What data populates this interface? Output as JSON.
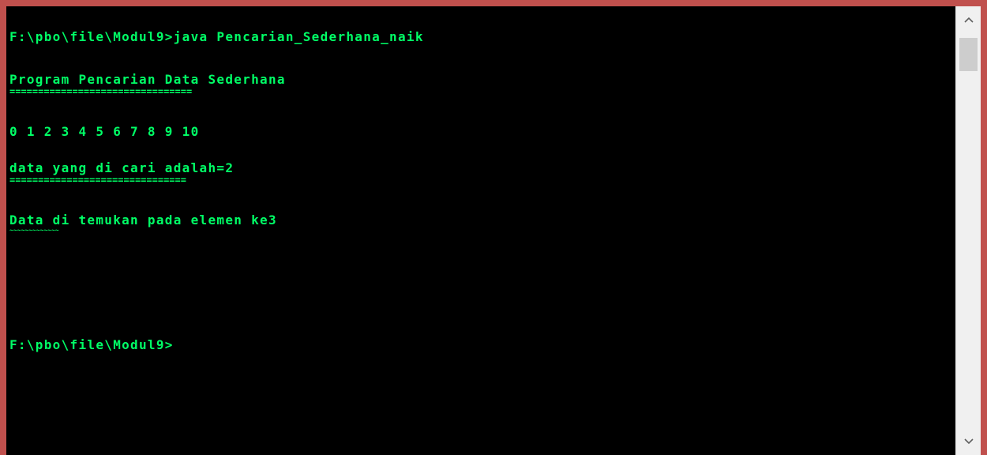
{
  "console": {
    "lines": [
      "F:\\pbo\\file\\Modul9>java Pencarian_Sederhana_naik",
      "Program Pencarian Data Sederhana",
      "0 1 2 3 4 5 6 7 8 9 10",
      "data yang di cari adalah=2",
      "Data di temukan pada elemen ke3",
      "F:\\pbo\\file\\Modul9>"
    ],
    "separators": [
      "================================",
      "==============================="
    ],
    "squiggle": "~~~~~~~~~~~~~"
  },
  "colors": {
    "text": "#00ff66",
    "background": "#000000",
    "frame": "#c0504d"
  },
  "scrollbar": {
    "up_icon": "chevron-up-icon",
    "down_icon": "chevron-down-icon"
  }
}
